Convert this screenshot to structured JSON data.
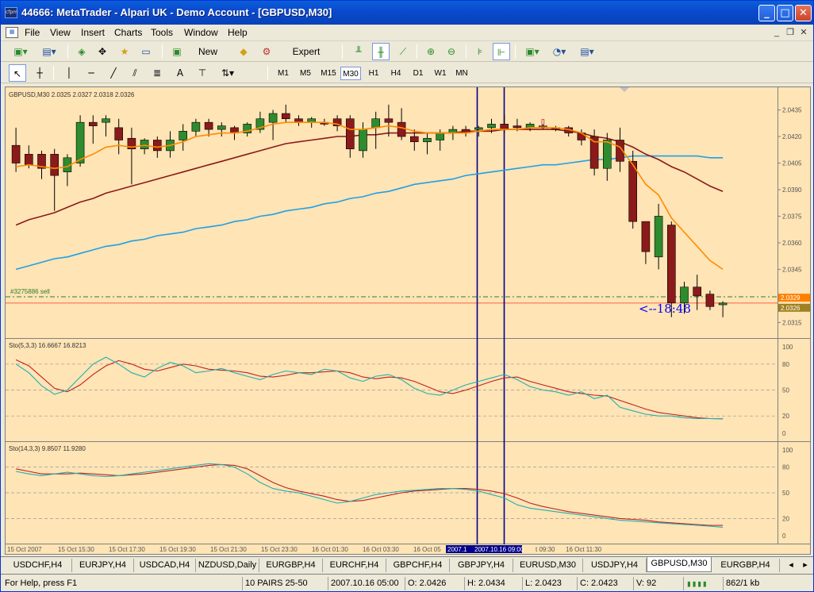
{
  "window": {
    "title": "44666: MetaTrader - Alpari UK - Demo Account - [GBPUSD,M30]",
    "app_icon": "cfpm"
  },
  "menu": [
    "File",
    "View",
    "Insert",
    "Charts",
    "Tools",
    "Window",
    "Help"
  ],
  "toolbar": {
    "new_order": "New Order",
    "expert_advisors": "Expert Advisors"
  },
  "timeframes": [
    "M1",
    "M5",
    "M15",
    "M30",
    "H1",
    "H4",
    "D1",
    "W1",
    "MN"
  ],
  "active_timeframe": "M30",
  "chart": {
    "header": "GBPUSD,M30  2.0325 2.0327 2.0318 2.0326",
    "order_label": "#3275886 sell",
    "countdown": "<--18:48",
    "price_ticks": [
      "2.0435",
      "2.0420",
      "2.0405",
      "2.0390",
      "2.0375",
      "2.0360",
      "2.0345",
      "2.0329",
      "2.0326",
      "2.0315"
    ],
    "sto1_header": "Sto(5,3,3) 16.6667 16.8213",
    "sto1_ticks": [
      "100",
      "80",
      "50",
      "20",
      "0"
    ],
    "sto2_header": "Sto(14,3,3) 9.8507 11.9280",
    "sto2_ticks": [
      "100",
      "80",
      "50",
      "20",
      "0"
    ],
    "time_labels": [
      "15 Oct 2007",
      "15 Oct 15:30",
      "15 Oct 17:30",
      "15 Oct 19:30",
      "15 Oct 21:30",
      "15 Oct 23:30",
      "16 Oct 01:30",
      "16 Oct 03:30",
      "16 Oct 05",
      "2007.1",
      "2007.10.16 09:00",
      "t 09:30",
      "16 Oct 11:30"
    ],
    "colors": {
      "bg": "#ffe4b5",
      "bull": "#2e8b2e",
      "bear": "#8b1a1a",
      "ma_fast": "#ff8c00",
      "ma_mid": "#8b1a1a",
      "ma_slow": "#1ea0e8",
      "vline": "#00008b",
      "countdown": "#0000ff"
    }
  },
  "chart_data": {
    "type": "candlestick",
    "symbol": "GBPUSD",
    "timeframe": "M30",
    "ylim": [
      2.0308,
      2.0446
    ],
    "candles": [
      [
        2.0415,
        2.0425,
        2.04,
        2.0405
      ],
      [
        2.041,
        2.0415,
        2.0402,
        2.0404
      ],
      [
        2.041,
        2.0412,
        2.0396,
        2.0402
      ],
      [
        2.041,
        2.0413,
        2.0378,
        2.0398
      ],
      [
        2.04,
        2.041,
        2.0392,
        2.0408
      ],
      [
        2.0405,
        2.0432,
        2.0403,
        2.0428
      ],
      [
        2.0428,
        2.0432,
        2.0416,
        2.0426
      ],
      [
        2.0428,
        2.0432,
        2.042,
        2.043
      ],
      [
        2.0425,
        2.043,
        2.041,
        2.0418
      ],
      [
        2.0419,
        2.0425,
        2.0393,
        2.0413
      ],
      [
        2.0413,
        2.0419,
        2.041,
        2.0418
      ],
      [
        2.0418,
        2.042,
        2.0408,
        2.0412
      ],
      [
        2.0412,
        2.0423,
        2.0408,
        2.0418
      ],
      [
        2.0418,
        2.0427,
        2.0412,
        2.0423
      ],
      [
        2.0423,
        2.043,
        2.042,
        2.0428
      ],
      [
        2.0428,
        2.043,
        2.042,
        2.0424
      ],
      [
        2.0424,
        2.0428,
        2.042,
        2.0426
      ],
      [
        2.0425,
        2.0426,
        2.0418,
        2.0422
      ],
      [
        2.0422,
        2.0428,
        2.042,
        2.0427
      ],
      [
        2.0424,
        2.0434,
        2.0422,
        2.043
      ],
      [
        2.0428,
        2.0435,
        2.0418,
        2.0433
      ],
      [
        2.0433,
        2.0438,
        2.0428,
        2.043
      ],
      [
        2.043,
        2.0432,
        2.0426,
        2.0428
      ],
      [
        2.0428,
        2.0431,
        2.0425,
        2.043
      ],
      [
        2.0428,
        2.043,
        2.0426,
        2.0427
      ],
      [
        2.043,
        2.0432,
        2.0423,
        2.0426
      ],
      [
        2.043,
        2.0432,
        2.0408,
        2.0413
      ],
      [
        2.0412,
        2.0428,
        2.0408,
        2.0424
      ],
      [
        2.0425,
        2.0434,
        2.0413,
        2.043
      ],
      [
        2.043,
        2.0438,
        2.042,
        2.0428
      ],
      [
        2.0428,
        2.0436,
        2.0418,
        2.042
      ],
      [
        2.042,
        2.0424,
        2.0412,
        2.0417
      ],
      [
        2.0417,
        2.0422,
        2.041,
        2.0419
      ],
      [
        2.0418,
        2.0424,
        2.0412,
        2.0422
      ],
      [
        2.0422,
        2.0426,
        2.0418,
        2.0424
      ],
      [
        2.0424,
        2.0426,
        2.042,
        2.0422
      ],
      [
        2.0424,
        2.0426,
        2.042,
        2.0425
      ],
      [
        2.0425,
        2.043,
        2.0422,
        2.0427
      ],
      [
        2.0427,
        2.0432,
        2.0422,
        2.0424
      ],
      [
        2.0426,
        2.043,
        2.0423,
        2.0425
      ],
      [
        2.0425,
        2.0428,
        2.0423,
        2.0427
      ],
      [
        2.0425,
        2.0427,
        2.0424,
        2.0426
      ],
      [
        2.0425,
        2.0426,
        2.0423,
        2.0424
      ],
      [
        2.0425,
        2.0426,
        2.042,
        2.0422
      ],
      [
        2.0422,
        2.0424,
        2.0415,
        2.0418
      ],
      [
        2.042,
        2.0424,
        2.0398,
        2.0402
      ],
      [
        2.0402,
        2.0422,
        2.0395,
        2.0418
      ],
      [
        2.0418,
        2.0425,
        2.04,
        2.0406
      ],
      [
        2.0406,
        2.0412,
        2.0368,
        2.0372
      ],
      [
        2.0372,
        2.0372,
        2.0348,
        2.0355
      ],
      [
        2.0352,
        2.0382,
        2.0345,
        2.0375
      ],
      [
        2.037,
        2.0372,
        2.0318,
        2.0326
      ],
      [
        2.0326,
        2.0338,
        2.032,
        2.0335
      ],
      [
        2.0335,
        2.0342,
        2.0322,
        2.033
      ],
      [
        2.0331,
        2.0333,
        2.0322,
        2.0324
      ],
      [
        2.0325,
        2.0327,
        2.0318,
        2.0326
      ]
    ],
    "ma_fast": [
      2.0403,
      2.0404,
      2.0403,
      2.0402,
      2.0403,
      2.0407,
      2.041,
      2.0414,
      2.0415,
      2.0414,
      2.0415,
      2.0414,
      2.0415,
      2.0417,
      2.042,
      2.0421,
      2.0422,
      2.0422,
      2.0423,
      2.0425,
      2.0427,
      2.0428,
      2.0428,
      2.0428,
      2.0428,
      2.0427,
      2.0424,
      2.0424,
      2.0425,
      2.0426,
      2.0425,
      2.0423,
      2.0422,
      2.0422,
      2.0422,
      2.0422,
      2.0423,
      2.0424,
      2.0424,
      2.0424,
      2.0425,
      2.0425,
      2.0425,
      2.0424,
      2.0422,
      2.0417,
      2.0417,
      2.0414,
      2.0404,
      2.0393,
      2.0387,
      2.0374,
      2.0366,
      2.0358,
      2.035,
      2.0345
    ],
    "ma_mid": [
      2.037,
      2.0373,
      2.0375,
      2.0377,
      2.038,
      2.0383,
      2.0385,
      2.0388,
      2.039,
      2.0392,
      2.0394,
      2.0396,
      2.0398,
      2.04,
      2.0402,
      2.0404,
      2.0406,
      2.0408,
      2.041,
      2.0412,
      2.0414,
      2.0416,
      2.0417,
      2.0418,
      2.0419,
      2.042,
      2.042,
      2.0421,
      2.0421,
      2.0422,
      2.0422,
      2.0422,
      2.0422,
      2.0422,
      2.0422,
      2.0423,
      2.0423,
      2.0423,
      2.0424,
      2.0424,
      2.0424,
      2.0424,
      2.0424,
      2.0423,
      2.0422,
      2.042,
      2.0419,
      2.0417,
      2.0414,
      2.041,
      2.0407,
      2.0403,
      2.04,
      2.0396,
      2.0392,
      2.0389
    ],
    "ma_slow": [
      2.0345,
      2.0347,
      2.0349,
      2.0351,
      2.0352,
      2.0354,
      2.0356,
      2.0358,
      2.0359,
      2.0361,
      2.0362,
      2.0364,
      2.0365,
      2.0366,
      2.0368,
      2.0369,
      2.037,
      2.0372,
      2.0373,
      2.0375,
      2.0376,
      2.0378,
      2.0379,
      2.038,
      2.0382,
      2.0383,
      2.0385,
      2.0386,
      2.0388,
      2.0389,
      2.0391,
      2.0393,
      2.0394,
      2.0395,
      2.0396,
      2.0398,
      2.0399,
      2.04,
      2.0401,
      2.0402,
      2.0403,
      2.0404,
      2.0404,
      2.0405,
      2.0406,
      2.0407,
      2.0407,
      2.0408,
      2.0409,
      2.0409,
      2.0409,
      2.0409,
      2.0409,
      2.0409,
      2.0408,
      2.0408
    ],
    "sto1_k": [
      80,
      70,
      55,
      45,
      50,
      65,
      80,
      88,
      80,
      70,
      65,
      75,
      82,
      78,
      70,
      72,
      75,
      70,
      66,
      62,
      68,
      72,
      70,
      68,
      74,
      72,
      64,
      60,
      66,
      68,
      62,
      52,
      46,
      44,
      50,
      56,
      60,
      64,
      68,
      62,
      54,
      50,
      48,
      44,
      48,
      40,
      44,
      30,
      26,
      22,
      20,
      20,
      18,
      17,
      17,
      16.6667
    ],
    "sto1_d": [
      85,
      78,
      65,
      52,
      48,
      56,
      68,
      78,
      84,
      80,
      74,
      72,
      76,
      80,
      78,
      74,
      73,
      72,
      70,
      66,
      65,
      67,
      70,
      70,
      71,
      72,
      70,
      65,
      63,
      65,
      64,
      60,
      54,
      48,
      46,
      50,
      55,
      60,
      64,
      65,
      60,
      56,
      52,
      48,
      46,
      44,
      43,
      38,
      33,
      28,
      24,
      22,
      20,
      18,
      17,
      16.8213
    ],
    "sto2_k": [
      75,
      72,
      70,
      72,
      74,
      72,
      70,
      69,
      70,
      72,
      74,
      76,
      78,
      80,
      82,
      84,
      83,
      80,
      72,
      62,
      55,
      52,
      50,
      46,
      42,
      38,
      40,
      44,
      48,
      50,
      52,
      53,
      54,
      55,
      55,
      54,
      52,
      48,
      44,
      36,
      32,
      30,
      28,
      26,
      24,
      22,
      20,
      18,
      17,
      16,
      15,
      14,
      13,
      12,
      11,
      9.8507
    ],
    "sto2_d": [
      78,
      75,
      72,
      72,
      72,
      73,
      72,
      71,
      70,
      71,
      72,
      74,
      76,
      78,
      80,
      82,
      83,
      82,
      78,
      70,
      62,
      56,
      52,
      49,
      46,
      42,
      40,
      41,
      44,
      47,
      50,
      52,
      53,
      54,
      55,
      55,
      54,
      52,
      49,
      44,
      38,
      34,
      31,
      28,
      26,
      24,
      22,
      20,
      19,
      18,
      16,
      15,
      14,
      13,
      12,
      11.928
    ]
  },
  "tabs": [
    "USDCHF,H4",
    "EURJPY,H4",
    "USDCAD,H4",
    "NZDUSD,Daily",
    "EURGBP,H4",
    "EURCHF,H4",
    "GBPCHF,H4",
    "GBPJPY,H4",
    "EURUSD,M30",
    "USDJPY,H4",
    "GBPUSD,M30",
    "EURGBP,H4"
  ],
  "active_tab": "GBPUSD,M30",
  "status": {
    "help": "For Help, press F1",
    "profile": "10 PAIRS 25-50",
    "time": "2007.10.16 05:00",
    "open": "O: 2.0426",
    "high": "H: 2.0434",
    "low": "L: 2.0423",
    "close": "C: 2.0423",
    "volume": "V: 92",
    "traffic": "862/1 kb"
  }
}
